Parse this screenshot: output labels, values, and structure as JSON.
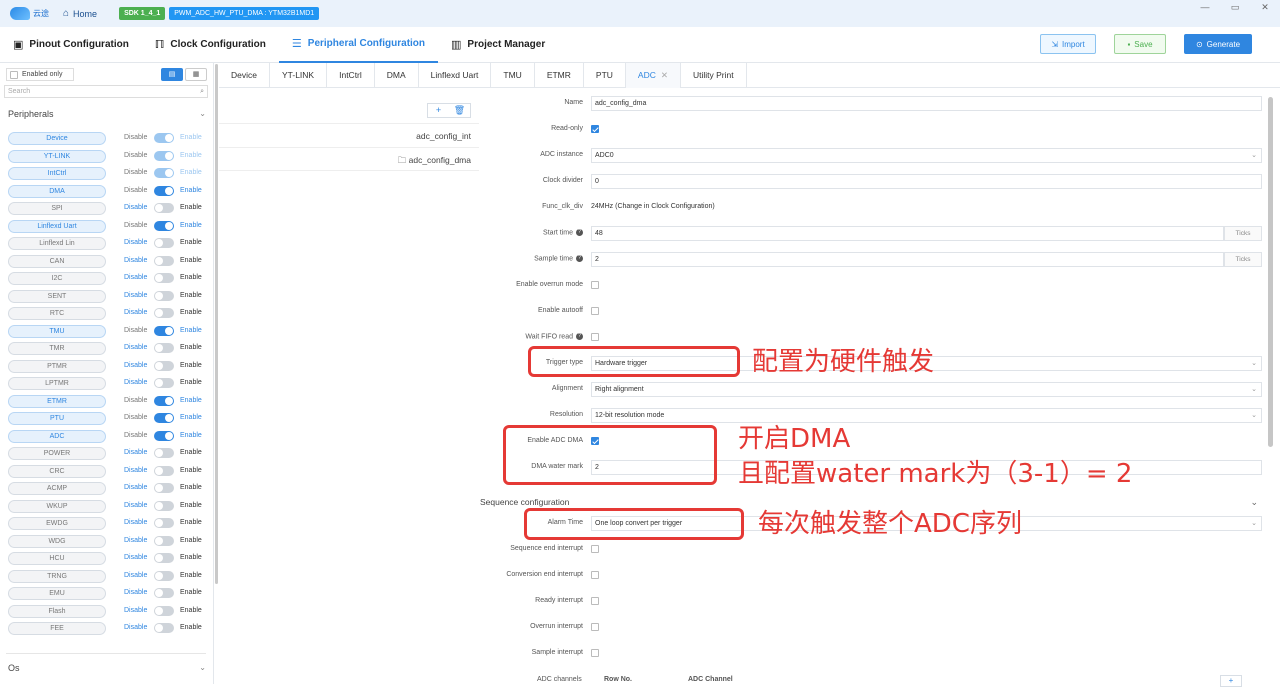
{
  "titlebar": {
    "logo_text": "云途",
    "home_label": "Home",
    "sdk_badge": "SDK 1_4_1",
    "project_badge": "PWM_ADC_HW_PTU_DMA : YTM32B1MD1"
  },
  "nav": {
    "tabs": [
      "Pinout Configuration",
      "Clock Configuration",
      "Peripheral Configuration",
      "Project Manager"
    ],
    "active": "Peripheral Configuration",
    "import_label": "Import",
    "save_label": "Save",
    "generate_label": "Generate"
  },
  "sidebar": {
    "enabled_only_label": "Enabled only",
    "search_placeholder": "Search",
    "section_peripherals": "Peripherals",
    "section_os": "Os",
    "disable_label": "Disable",
    "enable_label": "Enable",
    "items": [
      {
        "name": "Device",
        "state": "locked"
      },
      {
        "name": "YT-LINK",
        "state": "locked"
      },
      {
        "name": "IntCtrl",
        "state": "locked"
      },
      {
        "name": "DMA",
        "state": "on"
      },
      {
        "name": "SPI",
        "state": "off"
      },
      {
        "name": "Linflexd Uart",
        "state": "on"
      },
      {
        "name": "Linflexd Lin",
        "state": "off"
      },
      {
        "name": "CAN",
        "state": "off"
      },
      {
        "name": "I2C",
        "state": "off"
      },
      {
        "name": "SENT",
        "state": "off"
      },
      {
        "name": "RTC",
        "state": "off"
      },
      {
        "name": "TMU",
        "state": "on"
      },
      {
        "name": "TMR",
        "state": "off"
      },
      {
        "name": "PTMR",
        "state": "off"
      },
      {
        "name": "LPTMR",
        "state": "off"
      },
      {
        "name": "ETMR",
        "state": "on"
      },
      {
        "name": "PTU",
        "state": "on"
      },
      {
        "name": "ADC",
        "state": "on"
      },
      {
        "name": "POWER",
        "state": "off"
      },
      {
        "name": "CRC",
        "state": "off"
      },
      {
        "name": "ACMP",
        "state": "off"
      },
      {
        "name": "WKUP",
        "state": "off"
      },
      {
        "name": "EWDG",
        "state": "off"
      },
      {
        "name": "WDG",
        "state": "off"
      },
      {
        "name": "HCU",
        "state": "off"
      },
      {
        "name": "TRNG",
        "state": "off"
      },
      {
        "name": "EMU",
        "state": "off"
      },
      {
        "name": "Flash",
        "state": "off"
      },
      {
        "name": "FEE",
        "state": "off"
      }
    ]
  },
  "tabs": [
    "Device",
    "YT-LINK",
    "IntCtrl",
    "DMA",
    "Linflexd Uart",
    "TMU",
    "ETMR",
    "PTU",
    "ADC",
    "Utility Print"
  ],
  "active_tab": "ADC",
  "config_list": [
    "adc_config_int",
    "adc_config_dma"
  ],
  "form": {
    "name_label": "Name",
    "name_value": "adc_config_dma",
    "readonly_label": "Read-only",
    "instance_label": "ADC instance",
    "instance_value": "ADC0",
    "clkdiv_label": "Clock divider",
    "clkdiv_value": "0",
    "funcclk_label": "Func_clk_div",
    "funcclk_value": "24MHz (Change in Clock Configuration)",
    "start_label": "Start time",
    "start_value": "48",
    "sample_label": "Sample time",
    "sample_value": "2",
    "ticks": "Ticks",
    "overrun_label": "Enable overrun mode",
    "autooff_label": "Enable autooff",
    "waitfifo_label": "Wait FIFO read",
    "trigger_label": "Trigger type",
    "trigger_value": "Hardware trigger",
    "align_label": "Alignment",
    "align_value": "Right alignment",
    "res_label": "Resolution",
    "res_value": "12-bit resolution mode",
    "dma_label": "Enable ADC DMA",
    "watermark_label": "DMA water mark",
    "watermark_value": "2",
    "seq_section": "Sequence configuration",
    "alarm_label": "Alarm Time",
    "alarm_value": "One loop convert per trigger",
    "seqend_label": "Sequence end interrupt",
    "convend_label": "Conversion end interrupt",
    "ready_label": "Ready interrupt",
    "ovr_label": "Overrun interrupt",
    "sampint_label": "Sample interrupt",
    "adcch_label": "ADC channels",
    "rowno_label": "Row No.",
    "adcchan_label": "ADC Channel"
  },
  "annotations": {
    "trigger": "配置为硬件触发",
    "dma1": "开启DMA",
    "dma2": "且配置water mark为（3-1）= 2",
    "alarm": "每次触发整个ADC序列"
  },
  "colors": {
    "accent": "#2f86e0",
    "annotation": "#e53935",
    "save": "#4caf50"
  }
}
